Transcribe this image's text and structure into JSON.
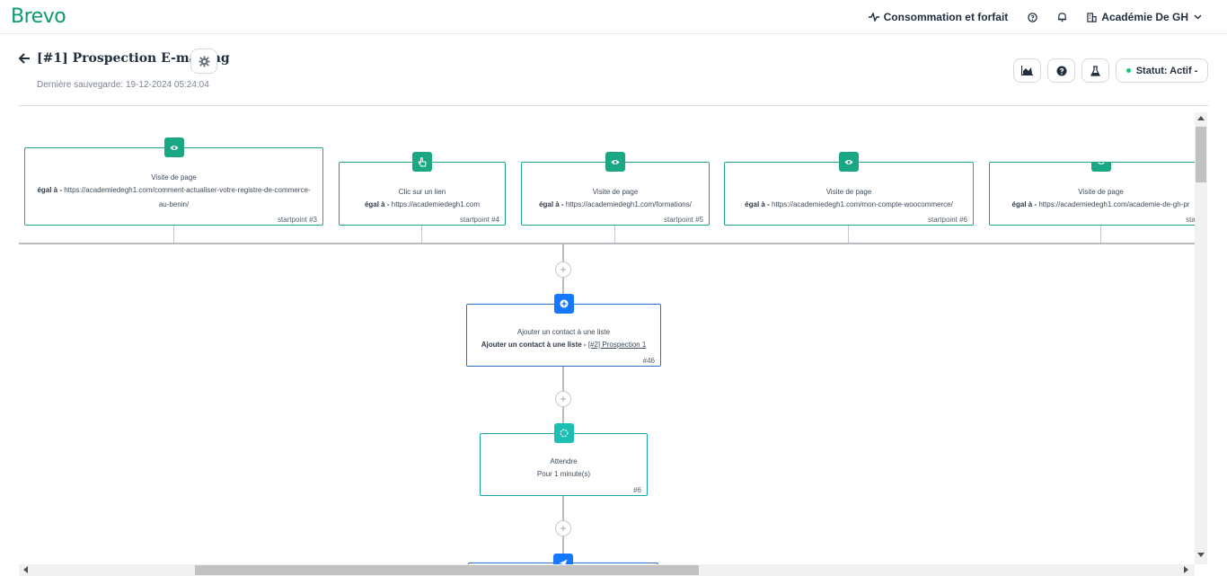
{
  "app": {
    "logo": "Brevo"
  },
  "topnav": {
    "consumption": "Consommation et forfait",
    "account": "Académie De GH"
  },
  "header": {
    "title": "[#1] Prospection E-mailing",
    "saved": "Dernière sauvegarde: 19-12-2024 05:24:04",
    "status": "Statut: Actif"
  },
  "startpoints": [
    {
      "title": "Visite de page",
      "label": "égal à",
      "value": "https://academiedegh1.com/comment-actualiser-votre-registre-de-commerce-au-benin/",
      "footer": "startpoint #3",
      "icon": "eye-icon"
    },
    {
      "title": "Clic sur un lien",
      "label": "égal à",
      "value": "https://academiedegh1.com",
      "footer": "startpoint #4",
      "icon": "pointer-icon"
    },
    {
      "title": "Visite de page",
      "label": "égal à",
      "value": "https://academiedegh1.com/formations/",
      "footer": "startpoint #5",
      "icon": "eye-icon"
    },
    {
      "title": "Visite de page",
      "label": "égal à",
      "value": "https://academiedegh1.com/mon-compte-woocommerce/",
      "footer": "startpoint #6",
      "icon": "eye-icon"
    },
    {
      "title": "Visite de page",
      "label": "égal à",
      "value": "https://academiedegh1.com/academie-de-gh-pr",
      "footer": "startpoint",
      "icon": "eye-icon"
    }
  ],
  "steps": {
    "add_contact": {
      "title": "Ajouter un contact à une liste",
      "label": "Ajouter un contact à une liste",
      "link": "[#2] Prospection 1",
      "footer": "#46"
    },
    "wait": {
      "title": "Attendre",
      "desc": "Pour 1 minute(s)",
      "footer": "#6"
    }
  },
  "colors": {
    "brand": "#0b996e",
    "node_green": "#1aa884",
    "node_blue": "#1677ff",
    "node_teal": "#1cbfb3",
    "status_dot": "#1cc47a"
  }
}
